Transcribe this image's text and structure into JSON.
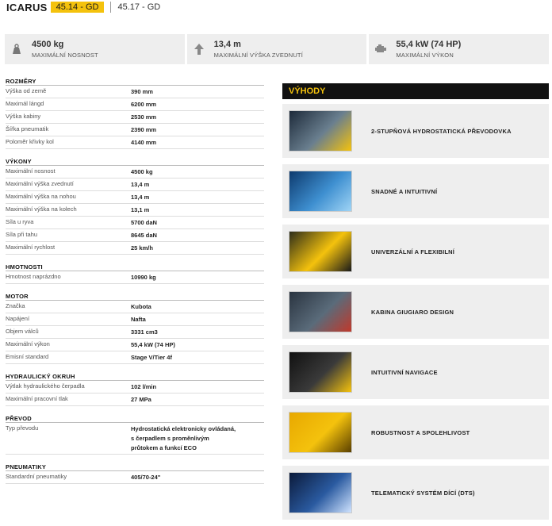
{
  "header": {
    "brand": "ICARUS",
    "active_tab": "45.14 - GD",
    "other_tab": "45.17 - GD"
  },
  "cards": [
    {
      "icon": "weight-icon",
      "value": "4500 kg",
      "label": "MAXIMÁLNÍ NOSNOST"
    },
    {
      "icon": "arrow-up-icon",
      "value": "13,4 m",
      "label": "MAXIMÁLNÍ VÝŠKA ZVEDNUTÍ"
    },
    {
      "icon": "engine-icon",
      "value": "55,4 kW (74 HP)",
      "label": "MAXIMÁLNÍ VÝKON"
    }
  ],
  "sections": [
    {
      "title": "ROZMĚRY",
      "rows": [
        [
          "Výška od země",
          "390 mm"
        ],
        [
          "Maximál lángd",
          "6200 mm"
        ],
        [
          "Výška kabiny",
          "2530 mm"
        ],
        [
          "Šířka pneumatik",
          "2390 mm"
        ],
        [
          "Poloměr křivky kol",
          "4140 mm"
        ]
      ]
    },
    {
      "title": "VÝKONY",
      "rows": [
        [
          "Maximální nosnost",
          "4500 kg"
        ],
        [
          "Maximální výška zvednutí",
          "13,4 m"
        ],
        [
          "Maximální výška na nohou",
          "13,4 m"
        ],
        [
          "Maximální výška na kolech",
          "13,1 m"
        ],
        [
          "Síla u ryva",
          "5700 daN"
        ],
        [
          "Síla při tahu",
          "8645 daN"
        ],
        [
          "Maximální rychlost",
          "25 km/h"
        ]
      ]
    },
    {
      "title": "HMOTNOSTI",
      "rows": [
        [
          "Hmotnost naprázdno",
          "10990 kg"
        ]
      ]
    },
    {
      "title": "MOTOR",
      "rows": [
        [
          "Značka",
          "Kubota"
        ],
        [
          "Napájení",
          "Nafta"
        ],
        [
          "Objem válců",
          "3331 cm3"
        ],
        [
          "Maximální výkon",
          "55,4 kW (74 HP)"
        ],
        [
          "Emisní standard",
          "Stage V/Tier 4f"
        ]
      ]
    },
    {
      "title": "HYDRAULICKÝ OKRUH",
      "rows": [
        [
          "Výtlak hydraulického čerpadla",
          "102 l/min"
        ],
        [
          "Maximální pracovní tlak",
          "27 MPa"
        ]
      ]
    },
    {
      "title": "PŘEVOD",
      "rows": [
        [
          "Typ převodu",
          "Hydrostatická elektronicky ovládaná,\ns čerpadlem s proměnlivým\nprůtokem a funkcí ECO"
        ]
      ]
    },
    {
      "title": "PNEUMATIKY",
      "rows": [
        [
          "Standardní pneumatiky",
          "405/70-24\""
        ]
      ]
    }
  ],
  "vyhody": {
    "title": "VÝHODY",
    "items": [
      {
        "label": "2-STUPŇOVÁ HYDROSTATICKÁ PŘEVODOVKA",
        "colors": [
          "#1d2a3a",
          "#6a7f8f",
          "#f4c20d"
        ]
      },
      {
        "label": "SNADNÉ A INTUITIVNÍ",
        "colors": [
          "#0d3a6e",
          "#3e8fd0",
          "#9fd4f5"
        ]
      },
      {
        "label": "UNIVERZÁLNÍ A FLEXIBILNÍ",
        "colors": [
          "#2d2d1a",
          "#f4c20d",
          "#1a1a1a"
        ]
      },
      {
        "label": "KABINA GIUGIARO DESIGN",
        "colors": [
          "#2a3440",
          "#5a6b7a",
          "#c0392b"
        ]
      },
      {
        "label": "INTUITIVNÍ NAVIGACE",
        "colors": [
          "#111111",
          "#3a3a3a",
          "#f4c20d"
        ]
      },
      {
        "label": "ROBUSTNOST A SPOLEHLIVOST",
        "colors": [
          "#e8a800",
          "#f4c20d",
          "#5a4000"
        ]
      },
      {
        "label": "TELEMATICKÝ SYSTÉM DÍCÍ (DTS)",
        "colors": [
          "#0b1a3a",
          "#2a5aa0",
          "#cfe3ff"
        ]
      }
    ]
  }
}
